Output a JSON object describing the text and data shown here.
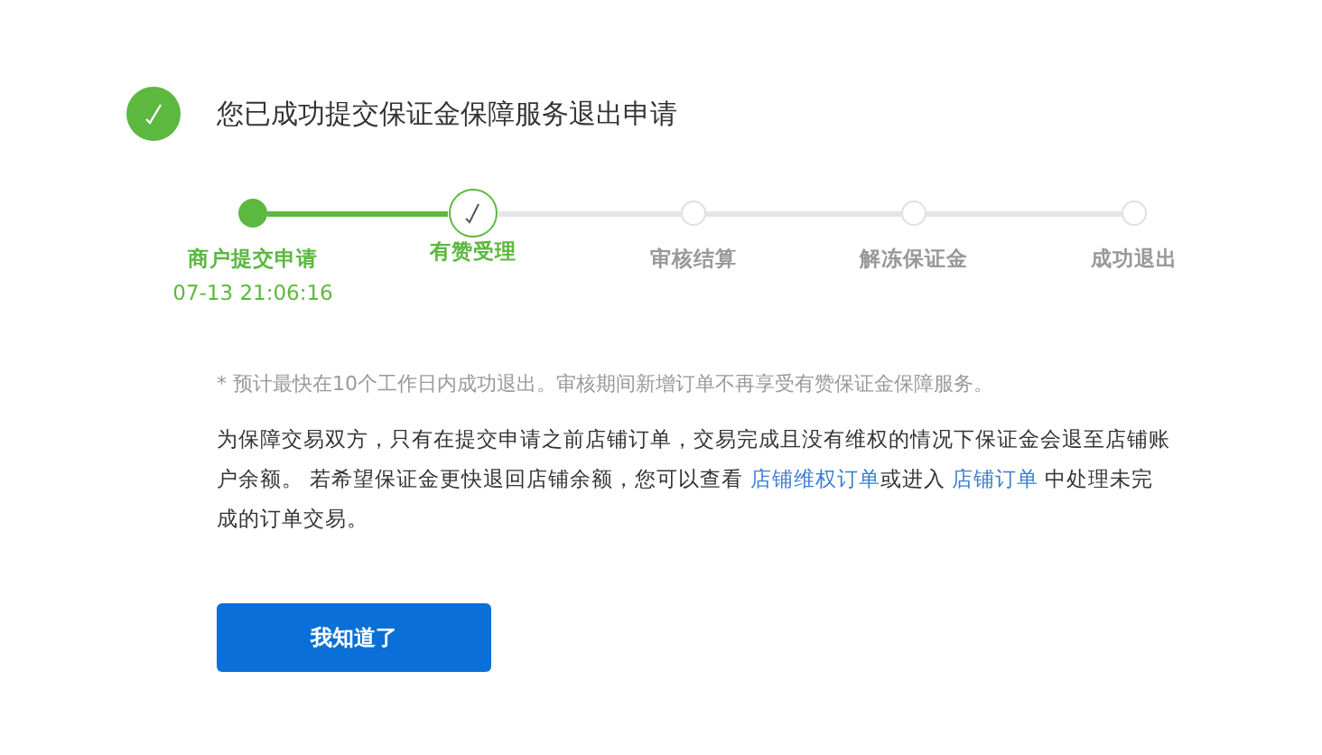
{
  "header": {
    "title": "您已成功提交保证金保障服务退出申请"
  },
  "steps": [
    {
      "label": "商户提交申请",
      "kind": "done",
      "time": "07-13 21:06:16"
    },
    {
      "label": "有赞受理",
      "kind": "current"
    },
    {
      "label": "审核结算",
      "kind": "pending"
    },
    {
      "label": "解冻保证金",
      "kind": "pending"
    },
    {
      "label": "成功退出",
      "kind": "pending"
    }
  ],
  "note": "* 预计最快在10个工作日内成功退出。审核期间新增订单不再享受有赞保证金保障服务。",
  "paragraph": [
    {
      "kind": "text",
      "text": "为保障交易双方，只有在提交申请之前店铺订单，交易完成且没有维权的情况下保证金会退至店铺账户余额。 若希望保证金更快退回店铺余额，您可以查看 "
    },
    {
      "kind": "link",
      "text": "店铺维权订单"
    },
    {
      "kind": "text",
      "text": "或进入 "
    },
    {
      "kind": "link",
      "text": "店铺订单"
    },
    {
      "kind": "text",
      "text": " 中处理未完成的订单交易。"
    }
  ],
  "button": "我知道了"
}
